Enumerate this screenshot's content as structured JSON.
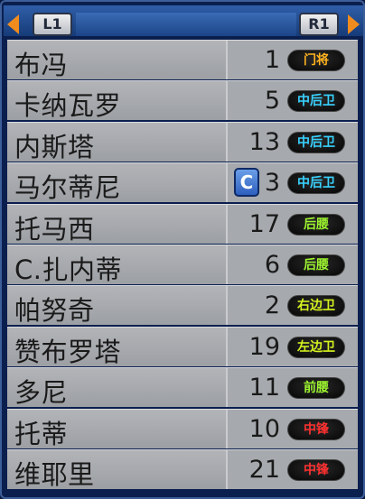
{
  "header": {
    "left_button": "L1",
    "right_button": "R1"
  },
  "players": [
    {
      "name": "布冯",
      "number": "1",
      "position": "门将",
      "pos_class": "gk"
    },
    {
      "name": "卡纳瓦罗",
      "number": "5",
      "position": "中后卫",
      "pos_class": "cb"
    },
    {
      "name": "内斯塔",
      "number": "13",
      "position": "中后卫",
      "pos_class": "cb"
    },
    {
      "name": "马尔蒂尼",
      "number": "3",
      "position": "中后卫",
      "pos_class": "cb",
      "captain": "C"
    },
    {
      "name": "托马西",
      "number": "17",
      "position": "后腰",
      "pos_class": "dm"
    },
    {
      "name": "C.扎内蒂",
      "number": "6",
      "position": "后腰",
      "pos_class": "dm"
    },
    {
      "name": "帕努奇",
      "number": "2",
      "position": "右边卫",
      "pos_class": "lb"
    },
    {
      "name": "赞布罗塔",
      "number": "19",
      "position": "左边卫",
      "pos_class": "lb"
    },
    {
      "name": "多尼",
      "number": "11",
      "position": "前腰",
      "pos_class": "dm"
    },
    {
      "name": "托蒂",
      "number": "10",
      "position": "中锋",
      "pos_class": "fw"
    },
    {
      "name": "维耶里",
      "number": "21",
      "position": "中锋",
      "pos_class": "fw"
    }
  ],
  "colors": {
    "goalkeeper": "#ffb21e",
    "center_back": "#38d2ff",
    "midfield": "#9cf22e",
    "full_back": "#d6f21e",
    "forward": "#ff3030",
    "arrow": "#f08c1e"
  }
}
